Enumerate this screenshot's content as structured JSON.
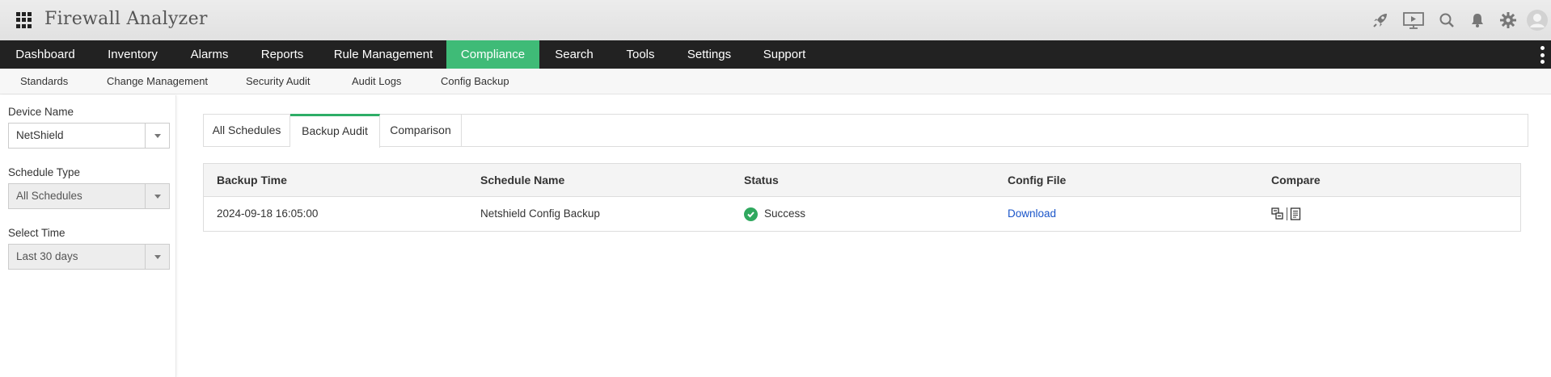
{
  "header": {
    "title": "Firewall Analyzer",
    "icons": [
      "rocket-icon",
      "presentation-icon",
      "search-icon",
      "bell-icon",
      "gear-icon",
      "user-avatar-icon"
    ]
  },
  "main_nav": {
    "items": [
      "Dashboard",
      "Inventory",
      "Alarms",
      "Reports",
      "Rule Management",
      "Compliance",
      "Search",
      "Tools",
      "Settings",
      "Support"
    ],
    "active": "Compliance",
    "accent_color": "#3fbb77"
  },
  "sub_nav": {
    "items": [
      "Standards",
      "Change Management",
      "Security Audit",
      "Audit Logs",
      "Config Backup"
    ]
  },
  "sidebar": {
    "device_name": {
      "label": "Device Name",
      "value": "NetShield"
    },
    "schedule_type": {
      "label": "Schedule Type",
      "value": "All Schedules"
    },
    "select_time": {
      "label": "Select Time",
      "value": "Last 30 days"
    }
  },
  "tabs": {
    "items": [
      "All Schedules",
      "Backup Audit",
      "Comparison"
    ],
    "active": "Backup Audit"
  },
  "table": {
    "columns": [
      "Backup Time",
      "Schedule Name",
      "Status",
      "Config File",
      "Compare"
    ],
    "rows": [
      {
        "backup_time": "2024-09-18 16:05:00",
        "schedule_name": "Netshield Config Backup",
        "status": "Success",
        "config_file": "Download"
      }
    ],
    "status_color": "#2fa85e",
    "link_color": "#1a55c9"
  }
}
